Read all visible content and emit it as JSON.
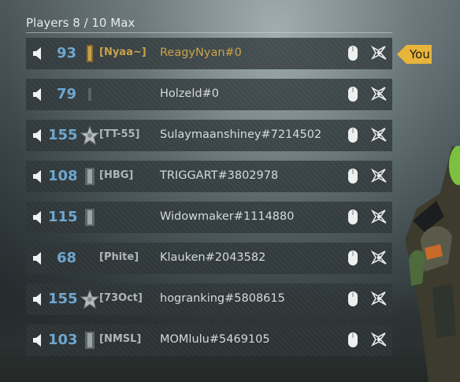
{
  "header": {
    "title": "Players 8 / 10 Max"
  },
  "you_tag": {
    "label": "You"
  },
  "colors": {
    "level": "#6fa7cf",
    "clan_gold": "#c9a24a",
    "you_tag_bg": "#e8b43a"
  },
  "players": [
    {
      "level": "93",
      "clan": "[Nyaa~]",
      "name": "ReagyNyan#0",
      "prestige": "bar-gold",
      "gold": true,
      "is_you": true
    },
    {
      "level": "79",
      "clan": "",
      "name": "Holzeld#0",
      "prestige": "bar-dark",
      "gold": false,
      "is_you": false
    },
    {
      "level": "155",
      "clan": "[TT-55]",
      "name": "Sulaymaanshiney#7214502",
      "prestige": "star-emblem",
      "gold": false,
      "is_you": false
    },
    {
      "level": "108",
      "clan": "[HBG]",
      "name": "TRIGGART#3802978",
      "prestige": "bar-silver",
      "gold": false,
      "is_you": false
    },
    {
      "level": "115",
      "clan": "",
      "name": "Widowmaker#1114880",
      "prestige": "bar-silver",
      "gold": false,
      "is_you": false
    },
    {
      "level": "68",
      "clan": "[Phite]",
      "name": "Klauken#2043582",
      "prestige": "none",
      "gold": false,
      "is_you": false
    },
    {
      "level": "155",
      "clan": "[73Oct]",
      "name": "hogranking#5808615",
      "prestige": "star-emblem",
      "gold": false,
      "is_you": false
    },
    {
      "level": "103",
      "clan": "[NMSL]",
      "name": "MOMlulu#5469105",
      "prestige": "bar-silver",
      "gold": false,
      "is_you": false
    }
  ]
}
